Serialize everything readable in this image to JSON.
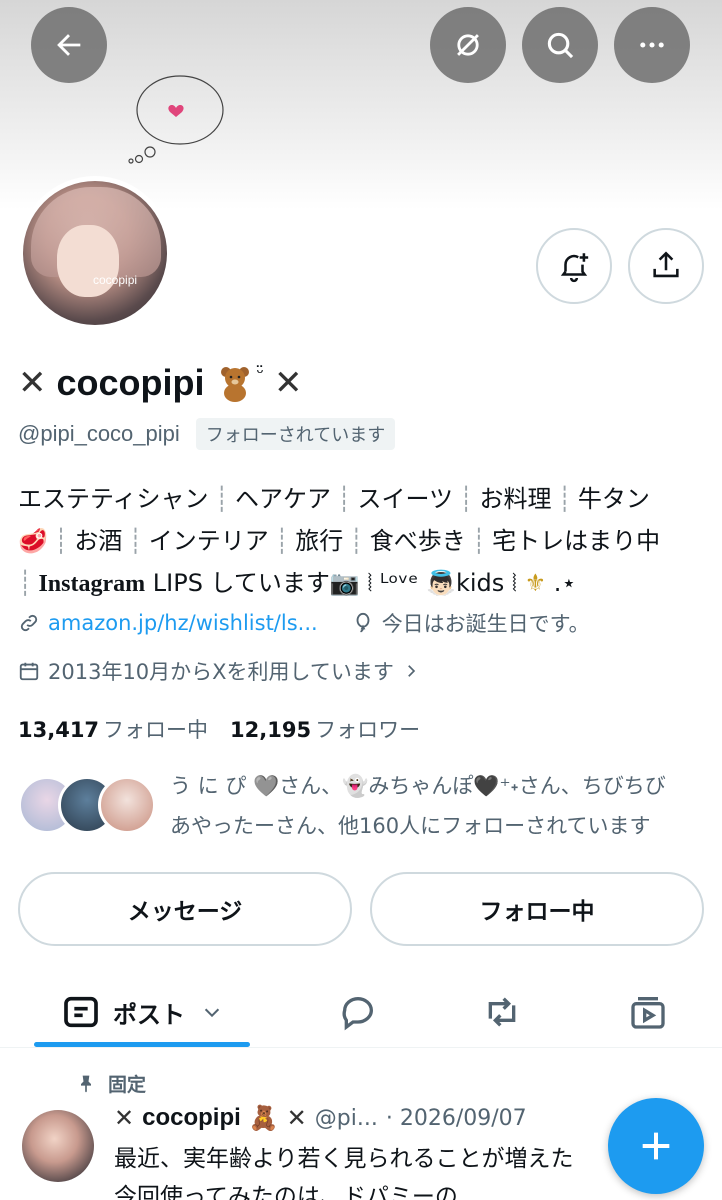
{
  "profile": {
    "name": "cocopipi",
    "handle": "@pipi_coco_pipi",
    "follows_you": "フォローされています",
    "avatar_text": "cocopipi",
    "name_decoration": "✕"
  },
  "bio": {
    "items_line1": [
      "エステティシャン",
      "ヘアケア",
      "スイーツ",
      "お料理",
      "牛タン"
    ],
    "items_line2": [
      "お酒",
      "インテリア",
      "旅行",
      "食べ歩き",
      "宅トレはまり中"
    ],
    "instagram": "Instagram",
    "line3_rest": "LIPS しています",
    "love": "ᴸᵒᵛᵉ",
    "kids": "kids",
    "tail": ".⋆"
  },
  "meta": {
    "link": "amazon.jp/hz/wishlist/ls...",
    "birthday": "今日はお誕生日です。",
    "joined": "2013年10月からXを利用しています"
  },
  "counts": {
    "following_num": "13,417",
    "following_label": "フォロー中",
    "followers_num": "12,195",
    "followers_label": "フォロワー"
  },
  "followed_by": {
    "line1": "う に ぴ 🩶さん、👻みちゃんぽ🖤⁺˖さん、ちびちび",
    "line2": "あやったーさん、他160人にフォローされています"
  },
  "buttons": {
    "message": "メッセージ",
    "following": "フォロー中"
  },
  "tabs": {
    "posts": "ポスト"
  },
  "post": {
    "pinned": "固定",
    "name": "cocopipi",
    "handle": "@pi...",
    "date": "· 2026/09/07",
    "line1": "最近、実年齢より若く見られることが増えた",
    "line2": "今回使ってみたのは、ドパミーの"
  },
  "icons": {
    "back": "back-arrow-icon",
    "mute": "mute-icon",
    "search": "search-icon",
    "more": "more-icon",
    "notify": "bell-plus-icon",
    "share": "share-icon",
    "link": "link-icon",
    "birthday": "balloon-icon",
    "calendar": "calendar-icon",
    "compose": "plus-icon"
  },
  "colors": {
    "accent": "#1d9bf0",
    "secondary_text": "#536471",
    "border": "#cfd9de"
  }
}
